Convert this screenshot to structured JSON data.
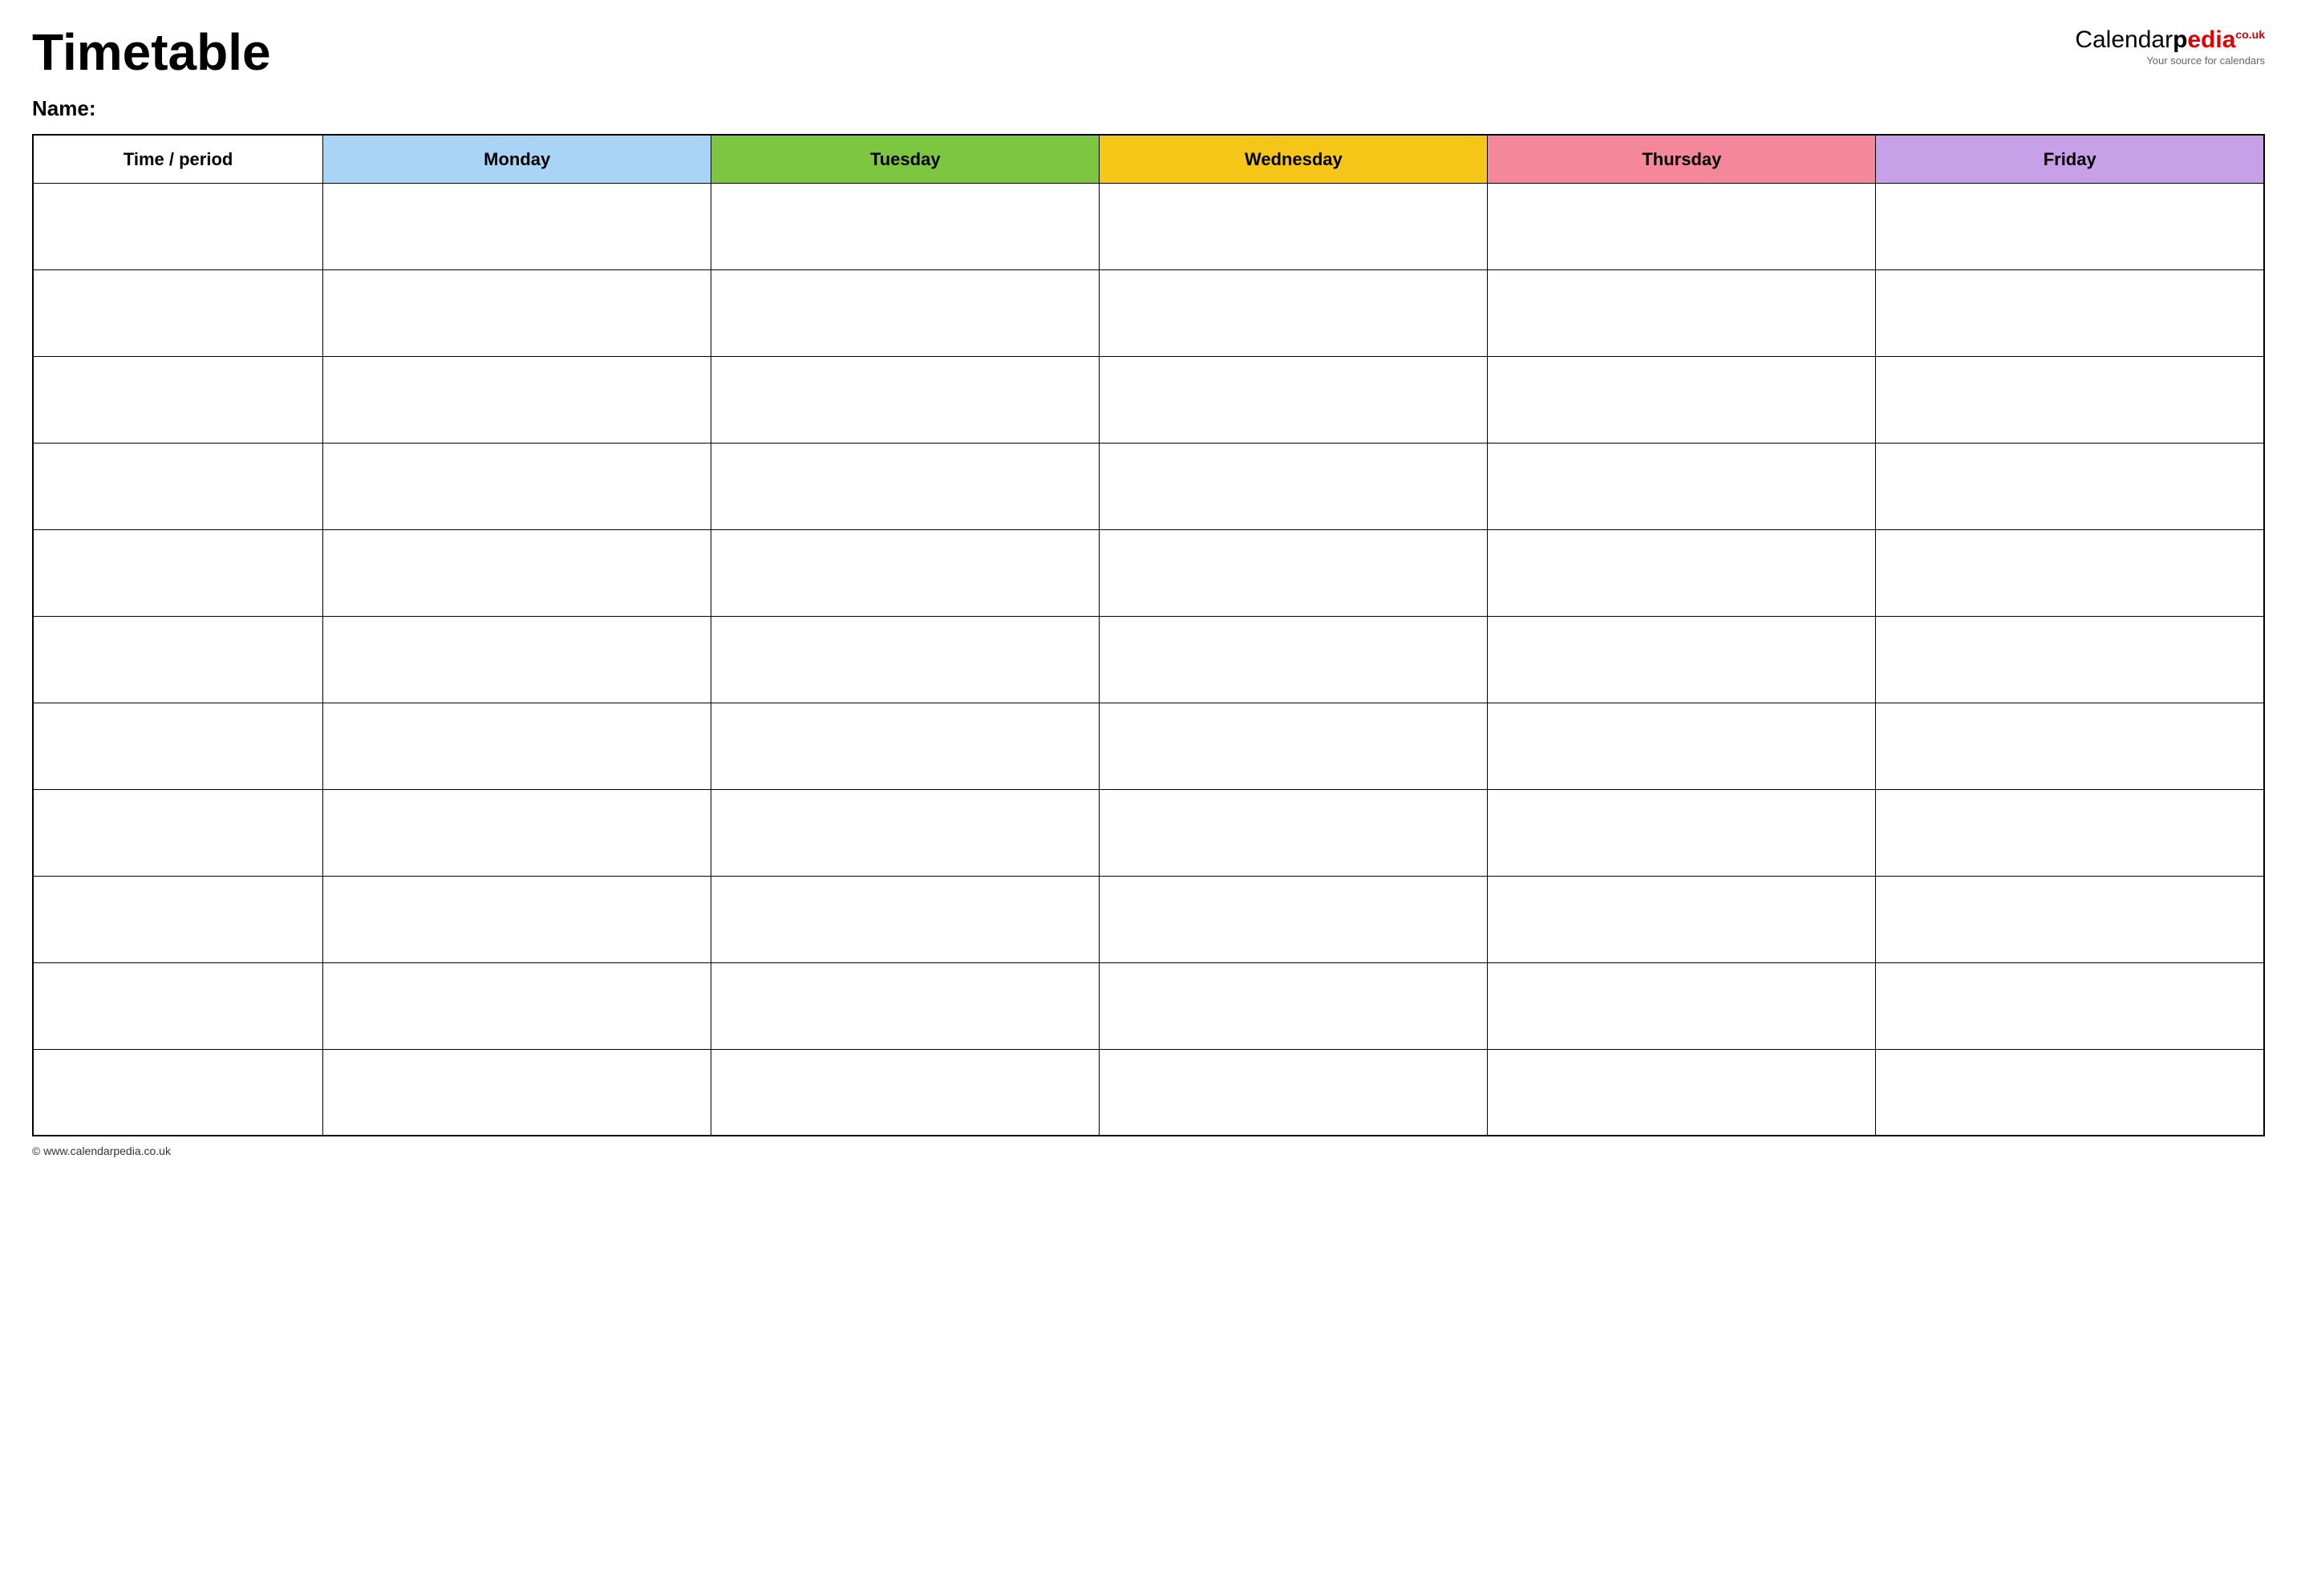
{
  "header": {
    "title": "Timetable",
    "logo": {
      "calendar_part": "Calendar",
      "p_part": "p",
      "edia_part": "edia",
      "couk": "co.uk",
      "subtitle": "Your source for calendars"
    },
    "name_label": "Name:"
  },
  "table": {
    "headers": [
      {
        "id": "time",
        "label": "Time / period",
        "color": "#ffffff",
        "class": "col-time"
      },
      {
        "id": "monday",
        "label": "Monday",
        "color": "#aad4f5",
        "class": "col-monday"
      },
      {
        "id": "tuesday",
        "label": "Tuesday",
        "color": "#7dc642",
        "class": "col-tuesday"
      },
      {
        "id": "wednesday",
        "label": "Wednesday",
        "color": "#f5c518",
        "class": "col-wednesday"
      },
      {
        "id": "thursday",
        "label": "Thursday",
        "color": "#f5879a",
        "class": "col-thursday"
      },
      {
        "id": "friday",
        "label": "Friday",
        "color": "#c8a0e8",
        "class": "col-friday"
      }
    ],
    "row_count": 11
  },
  "footer": {
    "url": "www.calendarpedia.co.uk"
  }
}
